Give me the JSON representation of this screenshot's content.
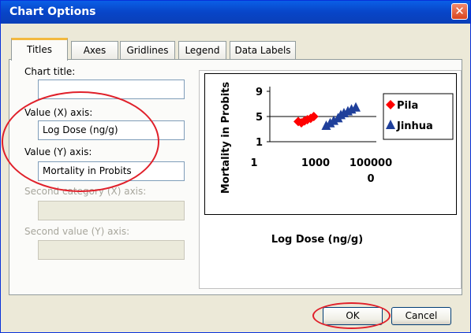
{
  "dialog": {
    "title": "Chart Options",
    "close_glyph": "✕"
  },
  "tabs": [
    "Titles",
    "Axes",
    "Gridlines",
    "Legend",
    "Data Labels"
  ],
  "form": {
    "chart_title_label": "Chart title:",
    "chart_title_value": "",
    "x_axis_label": "Value (X) axis:",
    "x_axis_value": "Log Dose (ng/g)",
    "y_axis_label": "Value (Y) axis:",
    "y_axis_value": "Mortality in Probits",
    "second_x_label": "Second category (X) axis:",
    "second_x_value": "",
    "second_y_label": "Second value (Y) axis:",
    "second_y_value": ""
  },
  "buttons": {
    "ok": "OK",
    "cancel": "Cancel"
  },
  "annotation_color": "#e0202a",
  "chart_data": {
    "type": "scatter",
    "title": "",
    "xlabel": "Log Dose (ng/g)",
    "ylabel": "Mortality in Probits",
    "x_scale": "log",
    "xlim": [
      1,
      1000000
    ],
    "ylim": [
      1,
      9
    ],
    "x_tick_labels": [
      "1",
      "1000",
      "100000",
      "0"
    ],
    "y_tick_labels": [
      "9",
      "5",
      "1"
    ],
    "gridlines": "horizontal at y=5",
    "legend_position": "right",
    "series": [
      {
        "name": "Pila",
        "marker": "diamond",
        "color": "#ff0000",
        "x": [
          40,
          60,
          90,
          130,
          200,
          300
        ],
        "y": [
          4.2,
          4.0,
          4.3,
          4.5,
          4.7,
          5.0
        ]
      },
      {
        "name": "Jinhua",
        "marker": "triangle",
        "color": "#1f3f9a",
        "x": [
          1500,
          2500,
          4000,
          7000,
          10000,
          15000,
          25000,
          40000,
          70000
        ],
        "y": [
          3.5,
          3.9,
          4.3,
          4.7,
          5.2,
          5.5,
          5.8,
          6.1,
          6.4
        ]
      }
    ]
  }
}
